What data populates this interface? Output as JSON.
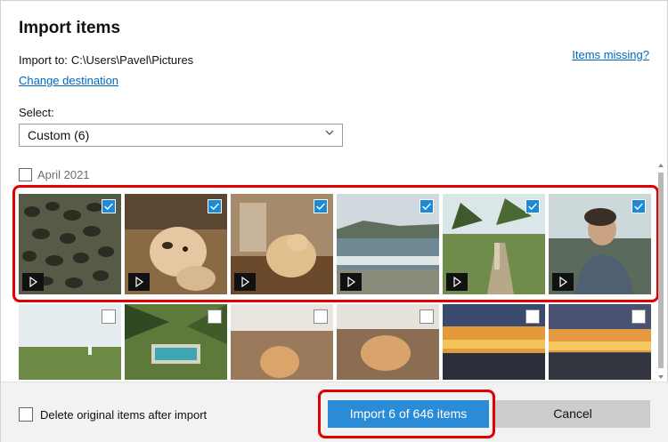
{
  "dialog": {
    "title": "Import items",
    "import_to_label": "Import to:",
    "import_to_path": "C:\\Users\\Pavel\\Pictures",
    "change_destination": "Change destination",
    "items_missing": "Items missing?"
  },
  "select": {
    "label": "Select:",
    "value": "Custom (6)"
  },
  "group": {
    "label": "April 2021",
    "checked": false
  },
  "tiles_row1": [
    {
      "name": "video-thumbnail",
      "selected": true,
      "type": "video"
    },
    {
      "name": "video-thumbnail",
      "selected": true,
      "type": "video"
    },
    {
      "name": "video-thumbnail",
      "selected": true,
      "type": "video"
    },
    {
      "name": "video-thumbnail",
      "selected": true,
      "type": "video"
    },
    {
      "name": "video-thumbnail",
      "selected": true,
      "type": "video"
    },
    {
      "name": "video-thumbnail",
      "selected": true,
      "type": "video"
    }
  ],
  "tiles_row2": [
    {
      "name": "photo-thumbnail",
      "selected": false
    },
    {
      "name": "photo-thumbnail",
      "selected": false
    },
    {
      "name": "photo-thumbnail",
      "selected": false
    },
    {
      "name": "photo-thumbnail",
      "selected": false
    },
    {
      "name": "photo-thumbnail",
      "selected": false
    },
    {
      "name": "photo-thumbnail",
      "selected": false
    }
  ],
  "footer": {
    "delete_option": "Delete original items after import",
    "delete_checked": false,
    "import_button": "Import 6 of 646 items",
    "cancel_button": "Cancel"
  },
  "colors": {
    "accent": "#2a8cd7",
    "link": "#0067c0",
    "highlight": "#e00000"
  },
  "icons": [
    "checkmark-icon",
    "play-icon",
    "chevron-down-icon"
  ]
}
